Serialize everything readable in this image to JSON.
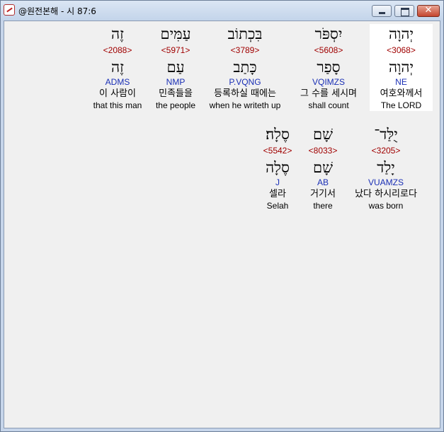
{
  "window": {
    "title": "@원전본해 - 시 87:6"
  },
  "rows": [
    [
      {
        "heb": "יְהוָה",
        "strong": "<3068>",
        "lemma": "יְהוָה",
        "morph": "NE",
        "kor": "여호와께서",
        "eng": "The LORD",
        "selected": true
      },
      {
        "heb": "יִסְפֹּר",
        "strong": "<5608>",
        "lemma": "סָפַר",
        "morph": "VQIMZS",
        "kor": "그 수를 세시며",
        "eng": "shall count"
      },
      {
        "heb": "בִּכְתוֹב",
        "strong": "<3789>",
        "lemma": "כָּתַב",
        "morph": "P.VQNG",
        "kor": "등록하실 때에는",
        "eng": "when he writeth up"
      },
      {
        "heb": "עַמִּים",
        "strong": "<5971>",
        "lemma": "עַם",
        "morph": "NMP",
        "kor": "민족들을",
        "eng": "the people"
      },
      {
        "heb": "זֶה",
        "strong": "<2088>",
        "lemma": "זֶה",
        "morph": "ADMS",
        "kor": "이 사람이",
        "eng": "that this man"
      }
    ],
    [
      {
        "heb": "יֻלַּד־",
        "strong": "<3205>",
        "lemma": "יָלַד",
        "morph": "VUAMZS",
        "kor": "났다 하시리로다",
        "eng": "was born"
      },
      {
        "heb": "שָׁם",
        "strong": "<8033>",
        "lemma": "שָׁם",
        "morph": "AB",
        "kor": "거기서",
        "eng": "there"
      },
      {
        "heb": "סֶלָה׃",
        "strong": "<5542>",
        "lemma": "סֶלָה",
        "morph": "J",
        "kor": "셀라",
        "eng": "Selah"
      }
    ]
  ]
}
